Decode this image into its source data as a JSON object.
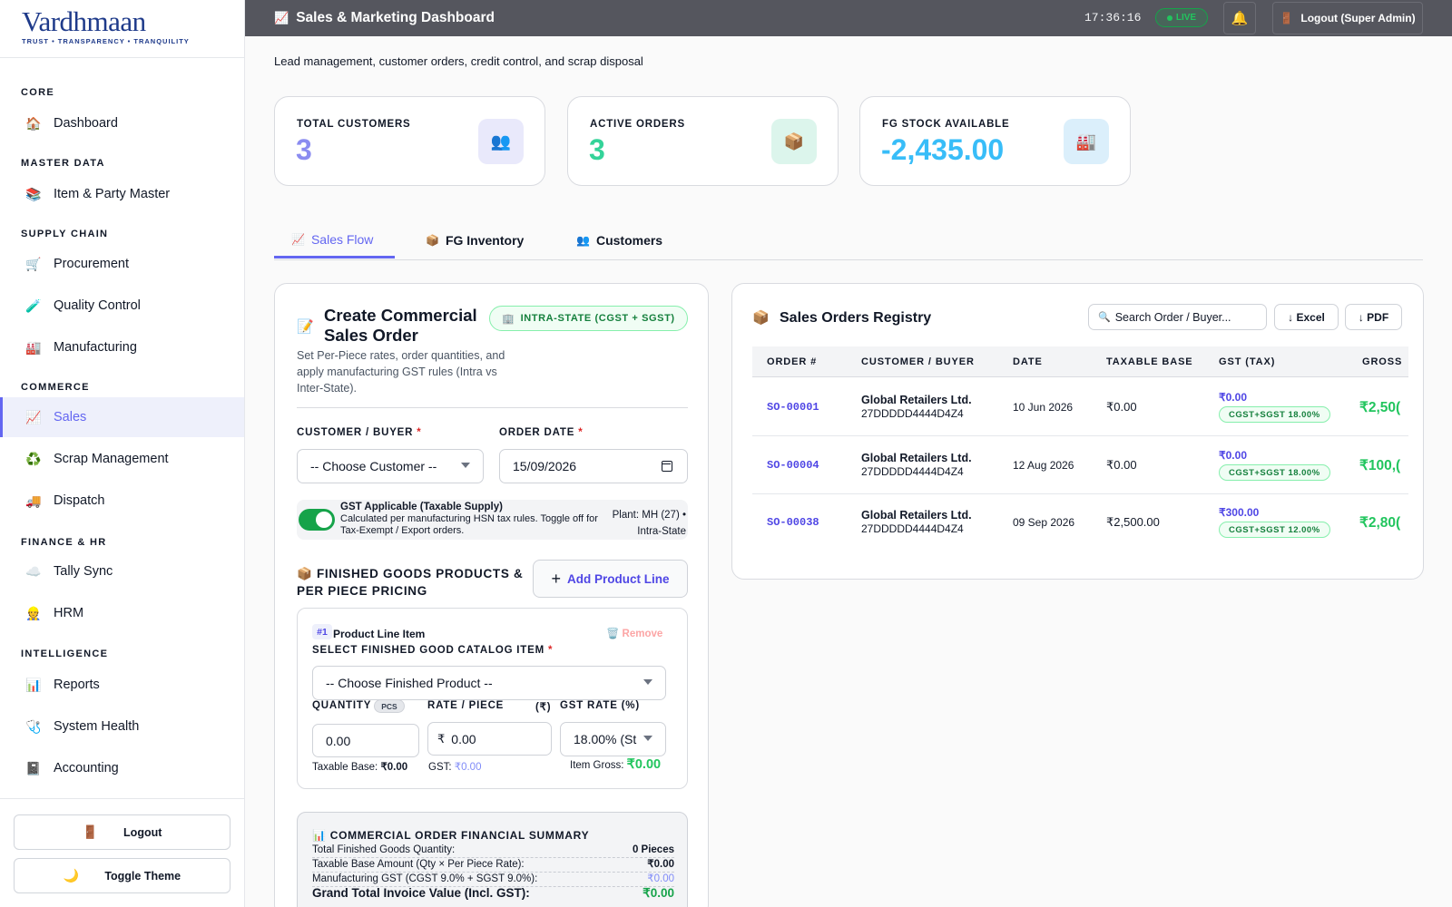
{
  "brand": {
    "logo_text": "Vardhmaan",
    "tagline": "TRUST • TRANSPARENCY • TRANQUILITY"
  },
  "sidebar": {
    "sections": [
      {
        "label": "CORE"
      },
      {
        "label": "MASTER DATA"
      },
      {
        "label": "SUPPLY CHAIN"
      },
      {
        "label": "COMMERCE"
      },
      {
        "label": "FINANCE & HR"
      },
      {
        "label": "INTELLIGENCE"
      }
    ],
    "items": [
      {
        "label": "Dashboard",
        "icon": "house-icon"
      },
      {
        "label": "Item & Party Master",
        "icon": "books-icon"
      },
      {
        "label": "Procurement",
        "icon": "cart-icon"
      },
      {
        "label": "Quality Control",
        "icon": "test-tube-icon"
      },
      {
        "label": "Manufacturing",
        "icon": "factory-icon"
      },
      {
        "label": "Sales",
        "icon": "chart-up-icon",
        "active": true
      },
      {
        "label": "Scrap Management",
        "icon": "recycle-icon"
      },
      {
        "label": "Dispatch",
        "icon": "truck-icon"
      },
      {
        "label": "Tally Sync",
        "icon": "cloud-icon"
      },
      {
        "label": "HRM",
        "icon": "worker-icon"
      },
      {
        "label": "Reports",
        "icon": "bar-chart-icon"
      },
      {
        "label": "System Health",
        "icon": "stethoscope-icon"
      },
      {
        "label": "Accounting",
        "icon": "ledger-icon"
      }
    ],
    "logout_label": "Logout",
    "theme_label": "Toggle Theme"
  },
  "header": {
    "title": "Sales & Marketing Dashboard",
    "clock": "17:36:16",
    "live_label": "LIVE",
    "logout_label": "Logout (Super Admin)"
  },
  "page": {
    "subtitle": "Lead management, customer orders, credit control, and scrap disposal"
  },
  "stats": [
    {
      "label": "TOTAL CUSTOMERS",
      "value": "3",
      "color": "#8b8cf0",
      "icon": "people-icon"
    },
    {
      "label": "ACTIVE ORDERS",
      "value": "3",
      "color": "#34d399",
      "icon": "package-icon"
    },
    {
      "label": "FG STOCK AVAILABLE",
      "value": "-2,435.00",
      "color": "#38bdf8",
      "icon": "factory-icon"
    }
  ],
  "tabs": [
    {
      "label": "Sales Flow",
      "active": true
    },
    {
      "label": "FG Inventory"
    },
    {
      "label": "Customers"
    }
  ],
  "form": {
    "title": "Create Commercial Sales Order",
    "gst_badge": "INTRA-STATE (CGST + SGST)",
    "description": "Set Per-Piece rates, order quantities, and apply manufacturing GST rules (Intra vs Inter-State).",
    "customer_label": "CUSTOMER / BUYER",
    "customer_value": "-- Choose Customer --",
    "date_label": "ORDER DATE",
    "date_value": "15/09/2026",
    "gst_toggle_title": "GST Applicable (Taxable Supply)",
    "gst_toggle_desc": "Calculated per manufacturing HSN tax rules. Toggle off for Tax-Exempt / Export orders.",
    "gst_toggle_on": true,
    "plant_info": "Plant: MH (27) • Intra-State",
    "products_heading": "FINISHED GOODS PRODUCTS & PER PIECE PRICING",
    "add_line_label": "Add Product Line",
    "line_item": {
      "number": "#1",
      "title": "Product Line Item",
      "remove_label": "Remove",
      "catalog_label": "SELECT FINISHED GOOD CATALOG ITEM",
      "catalog_value": "-- Choose Finished Product --",
      "qty_label": "QUANTITY",
      "qty_unit": "PCS",
      "qty_value": "0.00",
      "rate_label": "RATE / PIECE",
      "rate_unit": "(₹)",
      "rate_prefix": "₹",
      "rate_value": "0.00",
      "gst_rate_label": "GST RATE (%)",
      "gst_rate_value": "18.00% (St",
      "taxable_label": "Taxable Base:",
      "taxable_value": "₹0.00",
      "gst_label": "GST:",
      "gst_value": "₹0.00",
      "gross_label": "Item Gross:",
      "gross_value": "₹0.00"
    },
    "summary": {
      "title": "COMMERCIAL ORDER FINANCIAL SUMMARY",
      "rows": [
        {
          "label": "Total Finished Goods Quantity:",
          "value": "0 Pieces"
        },
        {
          "label": "Taxable Base Amount (Qty × Per Piece Rate):",
          "value": "₹0.00"
        },
        {
          "label": "Manufacturing GST (CGST 9.0% + SGST 9.0%):",
          "value": "₹0.00"
        },
        {
          "label": "Grand Total Invoice Value (Incl. GST):",
          "value": "₹0.00"
        }
      ]
    }
  },
  "orders": {
    "title": "Sales Orders Registry",
    "search_placeholder": "Search Order / Buyer...",
    "excel_label": "↓ Excel",
    "pdf_label": "↓ PDF",
    "columns": [
      "ORDER #",
      "CUSTOMER / BUYER",
      "DATE",
      "TAXABLE BASE",
      "GST (TAX)",
      "GROSS"
    ],
    "rows": [
      {
        "id": "SO-00001",
        "customer": "Global Retailers Ltd.",
        "gstin": "27DDDDD4444D4Z4",
        "date": "10 Jun 2026",
        "taxable": "₹0.00",
        "gst": "₹0.00",
        "gst_chip": "CGST+SGST 18.00%",
        "gross": "₹2,50("
      },
      {
        "id": "SO-00004",
        "customer": "Global Retailers Ltd.",
        "gstin": "27DDDDD4444D4Z4",
        "date": "12 Aug 2026",
        "taxable": "₹0.00",
        "gst": "₹0.00",
        "gst_chip": "CGST+SGST 18.00%",
        "gross": "₹100,("
      },
      {
        "id": "SO-00038",
        "customer": "Global Retailers Ltd.",
        "gstin": "27DDDDD4444D4Z4",
        "date": "09 Sep 2026",
        "taxable": "₹2,500.00",
        "gst": "₹300.00",
        "gst_chip": "CGST+SGST 12.00%",
        "gross": "₹2,80("
      }
    ]
  }
}
